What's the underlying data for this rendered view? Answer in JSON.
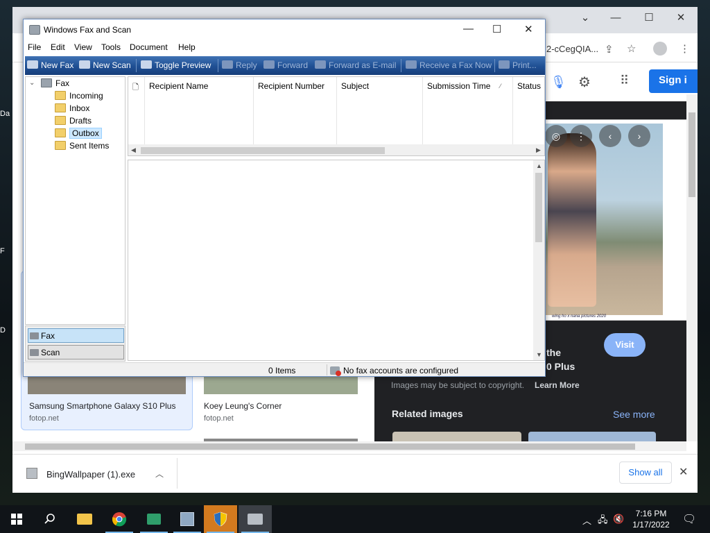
{
  "desktop": {
    "stub_labels": [
      "Da",
      "F",
      "D"
    ]
  },
  "chrome": {
    "address_fragment": "2-cCegQIA...",
    "sign_in": "Sign i",
    "visit_label": "Visit",
    "heading_fragment_1": "the",
    "heading_fragment_2": "0 Plus",
    "disclaimer": "Images may be subject to copyright.",
    "learn_more": "Learn More",
    "related_title": "Related images",
    "see_more": "See more",
    "image_caption": "wing ho x nana pictures 2020",
    "cards": [
      {
        "title": "Samsung Smartphone Galaxy S10 Plus",
        "source": "fotop.net"
      },
      {
        "title": "Koey Leung's Corner",
        "source": "fotop.net"
      }
    ],
    "download": {
      "file_name": "BingWallpaper (1).exe",
      "show_all": "Show all"
    }
  },
  "fax": {
    "title": "Windows Fax and Scan",
    "menu": [
      "File",
      "Edit",
      "View",
      "Tools",
      "Document",
      "Help"
    ],
    "toolbar": {
      "new_fax": "New Fax",
      "new_scan": "New Scan",
      "toggle_preview": "Toggle Preview",
      "reply": "Reply",
      "forward": "Forward",
      "forward_email": "Forward as E-mail",
      "receive_fax": "Receive a Fax Now",
      "print": "Print..."
    },
    "tree": {
      "root": "Fax",
      "items": [
        "Incoming",
        "Inbox",
        "Drafts",
        "Outbox",
        "Sent Items"
      ],
      "selected": "Outbox"
    },
    "nav_buttons": [
      "Fax",
      "Scan"
    ],
    "columns": [
      "Recipient Name",
      "Recipient Number",
      "Subject",
      "Submission Time",
      "Status"
    ],
    "status": {
      "items": "0 Items",
      "message": "No fax accounts are configured"
    }
  },
  "taskbar": {
    "time": "7:16 PM",
    "date": "1/17/2022"
  },
  "colors": {
    "toolbar_blue": "#1f4f93",
    "chrome_blue": "#1a73e8",
    "dark_panel": "#202124",
    "active_app": "#d37a1f"
  }
}
